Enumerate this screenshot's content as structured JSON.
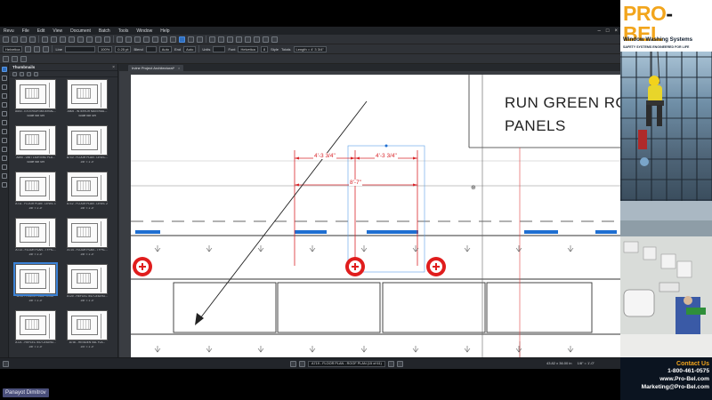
{
  "menu": [
    "Revu",
    "File",
    "Edit",
    "View",
    "Document",
    "Batch",
    "Tools",
    "Window",
    "Help"
  ],
  "toolbar": {
    "font_family": "Helvetica",
    "zoom": "100%",
    "line_width": "0.25 pt",
    "line_label": "Line",
    "blend": "Blend",
    "auto1": "Auto",
    "end_label": "End",
    "auto2": "Auto",
    "units_label": "Units",
    "font_label": "Font",
    "font_value": "Helvetica",
    "font_size": "8",
    "style_label": "Style",
    "totals_label": "Totals",
    "totals_value": "Length = 4' 3 3/4\""
  },
  "thumbnails": {
    "header": "Thumbnails",
    "items": [
      {
        "title": "A500 - EXTERIOR MATERIAL...",
        "scale": "Scale Not Set"
      },
      {
        "title": "A505 - INTERIOR MATERIAL...",
        "scale": "Scale Not Set"
      },
      {
        "title": "A590 - UNIT LIGHTING PLA...",
        "scale": "Scale Not Set"
      },
      {
        "title": "A710 - FLOOR PLAN - LEVEL...",
        "scale": "1/8\" = 1'-0\""
      },
      {
        "title": "A711 - FLOOR PLAN - LEVEL 1",
        "scale": "1/8\" = 1'-0\""
      },
      {
        "title": "A712 - FLOOR PLAN - LEVEL 2",
        "scale": "1/8\" = 1'-0\""
      },
      {
        "title": "A713 - FLOOR PLAN - TYPIC...",
        "scale": "1/8\" = 1'-0\""
      },
      {
        "title": "A714 - FLOOR PLAN - TYPIC...",
        "scale": "1/8\" = 1'-0\""
      },
      {
        "title": "A719 - FLOOR PLAN - ROOF",
        "scale": "1/8\" = 1'-0\"",
        "active": true
      },
      {
        "title": "A720 - REFLECTED CEILING...",
        "scale": "1/8\" = 1'-0\""
      },
      {
        "title": "A721 - REFLECTED CEILING...",
        "scale": "1/8\" = 1'-0\""
      },
      {
        "title": "A730 - RESIDENTIAL FLA...",
        "scale": "1/4\" = 1'-0\""
      }
    ]
  },
  "document_tab": "Irvine Project Architectural*",
  "drawing": {
    "title_line1": "RUN GREEN RO",
    "title_line2": "PANELS",
    "dim_left": "4'-3 3/4\"",
    "dim_right": "4'-3 3/4\"",
    "dim_total": "8'-7\""
  },
  "statusbar": {
    "page": "A719 - FLOOR PLAN - ROOF PLAN (15 of 61)",
    "size": "43.82 x 36.00 in",
    "scale": "1/8\" = 1'-0\""
  },
  "presenter": "Panayot Dimitrov",
  "ad": {
    "brand_a": "PRO",
    "brand_dash": "-",
    "brand_b": "BEL",
    "tagline": "SAFETY SYSTEMS ENGINEERED FOR LIFE",
    "heading": "Window Washing Systems",
    "contact_title": "Contact Us",
    "phone": "1-800-461-0575",
    "web": "www.Pro-Bel.com",
    "email": "Marketing@Pro-Bel.com"
  },
  "colors": {
    "markup_red": "#d9262b",
    "accent_blue": "#1f6fd1",
    "brand_orange": "#f2a51c"
  }
}
